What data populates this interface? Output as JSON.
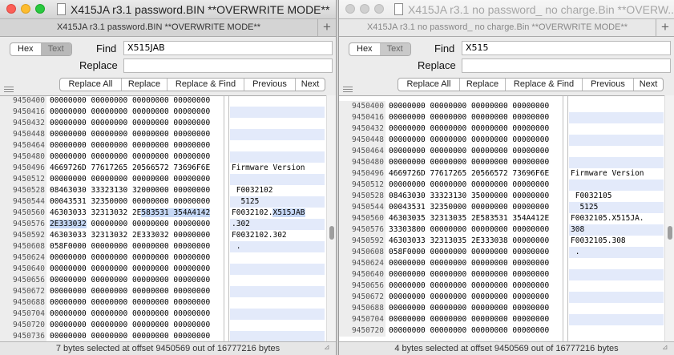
{
  "left": {
    "title": "X415JA r3.1 password.BIN **OVERWRITE MODE**",
    "tab_label": "X415JA r3.1 password.BIN **OVERWRITE MODE**",
    "mode_hex": "Hex",
    "mode_text": "Text",
    "find_label": "Find",
    "find_value": "X515JAB",
    "replace_label": "Replace",
    "replace_value": "",
    "buttons": [
      "Replace All",
      "Replace",
      "Replace & Find",
      "Previous",
      "Next"
    ],
    "status": "7 bytes selected at offset 9450569 out of 16777216 bytes",
    "rows": [
      {
        "off": "9450400",
        "hex": "00000000 00000000 00000000 00000000",
        "asc": ""
      },
      {
        "off": "9450416",
        "hex": "00000000 00000000 00000000 00000000",
        "asc": ""
      },
      {
        "off": "9450432",
        "hex": "00000000 00000000 00000000 00000000",
        "asc": ""
      },
      {
        "off": "9450448",
        "hex": "00000000 00000000 00000000 00000000",
        "asc": ""
      },
      {
        "off": "9450464",
        "hex": "00000000 00000000 00000000 00000000",
        "asc": ""
      },
      {
        "off": "9450480",
        "hex": "00000000 00000000 00000000 00000000",
        "asc": ""
      },
      {
        "off": "9450496",
        "hex": "4669726D 77617265 20566572 73696F6E",
        "asc": "Firmware Version"
      },
      {
        "off": "9450512",
        "hex": "00000000 00000000 00000000 00000000",
        "asc": ""
      },
      {
        "off": "9450528",
        "hex": "08463030 33323130 32000000 00000000",
        "asc": " F0032102"
      },
      {
        "off": "9450544",
        "hex": "00043531 32350000 00000000 00000000",
        "asc": "  5125"
      },
      {
        "off": "9450560",
        "hex_pre": "46303033 32313032 2E",
        "hex_sel": "583531 354A4142",
        "hex_post": "",
        "asc_pre": "F0032102.",
        "asc_sel": "X515JAB",
        "asc_post": ""
      },
      {
        "off": "9450576",
        "hex_pre": "",
        "hex_sel": "2E333032",
        "hex_post": " 00000000 00000000 00000000",
        "asc_pre": ".302",
        "asc_sel": "",
        "asc_post": ""
      },
      {
        "off": "9450592",
        "hex": "46303033 32313032 2E333032 00000000",
        "asc": "F0032102.302"
      },
      {
        "off": "9450608",
        "hex": "058F0000 00000000 00000000 00000000",
        "asc": " ."
      },
      {
        "off": "9450624",
        "hex": "00000000 00000000 00000000 00000000",
        "asc": ""
      },
      {
        "off": "9450640",
        "hex": "00000000 00000000 00000000 00000000",
        "asc": ""
      },
      {
        "off": "9450656",
        "hex": "00000000 00000000 00000000 00000000",
        "asc": ""
      },
      {
        "off": "9450672",
        "hex": "00000000 00000000 00000000 00000000",
        "asc": ""
      },
      {
        "off": "9450688",
        "hex": "00000000 00000000 00000000 00000000",
        "asc": ""
      },
      {
        "off": "9450704",
        "hex": "00000000 00000000 00000000 00000000",
        "asc": ""
      },
      {
        "off": "9450720",
        "hex": "00000000 00000000 00000000 00000000",
        "asc": ""
      },
      {
        "off": "9450736",
        "hex": "00000000 00000000 00000000 00000000",
        "asc": ""
      }
    ]
  },
  "right": {
    "title": "X415JA r3.1 no password_ no charge.Bin **OVERW...",
    "tab_label": "X415JA r3.1 no password_ no charge.Bin **OVERWRITE MODE**",
    "mode_hex": "Hex",
    "mode_text": "Text",
    "find_label": "Find",
    "find_value": "X515",
    "replace_label": "Replace",
    "replace_value": "",
    "buttons": [
      "Replace All",
      "Replace",
      "Replace & Find",
      "Previous",
      "Next"
    ],
    "status": "4 bytes selected at offset 9450569 out of 16777216 bytes",
    "rows": [
      {
        "off": "9450400",
        "hex": "00000000 00000000 00000000 00000000",
        "asc": ""
      },
      {
        "off": "9450416",
        "hex": "00000000 00000000 00000000 00000000",
        "asc": ""
      },
      {
        "off": "9450432",
        "hex": "00000000 00000000 00000000 00000000",
        "asc": ""
      },
      {
        "off": "9450448",
        "hex": "00000000 00000000 00000000 00000000",
        "asc": ""
      },
      {
        "off": "9450464",
        "hex": "00000000 00000000 00000000 00000000",
        "asc": ""
      },
      {
        "off": "9450480",
        "hex": "00000000 00000000 00000000 00000000",
        "asc": ""
      },
      {
        "off": "9450496",
        "hex": "4669726D 77617265 20566572 73696F6E",
        "asc": "Firmware Version"
      },
      {
        "off": "9450512",
        "hex": "00000000 00000000 00000000 00000000",
        "asc": ""
      },
      {
        "off": "9450528",
        "hex": "08463030 33323130 35000000 00000000",
        "asc": " F0032105"
      },
      {
        "off": "9450544",
        "hex": "00043531 32350000 00000000 00000000",
        "asc": "  5125"
      },
      {
        "off": "9450560",
        "hex": "46303035 32313035 2E583531 354A412E",
        "asc": "F0032105.X515JA."
      },
      {
        "off": "9450576",
        "hex": "33303800 00000000 00000000 00000000",
        "asc": "308"
      },
      {
        "off": "9450592",
        "hex": "46303033 32313035 2E333038 00000000",
        "asc": "F0032105.308"
      },
      {
        "off": "9450608",
        "hex": "058F0000 00000000 00000000 00000000",
        "asc": " ."
      },
      {
        "off": "9450624",
        "hex": "00000000 00000000 00000000 00000000",
        "asc": ""
      },
      {
        "off": "9450640",
        "hex": "00000000 00000000 00000000 00000000",
        "asc": ""
      },
      {
        "off": "9450656",
        "hex": "00000000 00000000 00000000 00000000",
        "asc": ""
      },
      {
        "off": "9450672",
        "hex": "00000000 00000000 00000000 00000000",
        "asc": ""
      },
      {
        "off": "9450688",
        "hex": "00000000 00000000 00000000 00000000",
        "asc": ""
      },
      {
        "off": "9450704",
        "hex": "00000000 00000000 00000000 00000000",
        "asc": ""
      },
      {
        "off": "9450720",
        "hex": "00000000 00000000 00000000 00000000",
        "asc": ""
      }
    ]
  }
}
